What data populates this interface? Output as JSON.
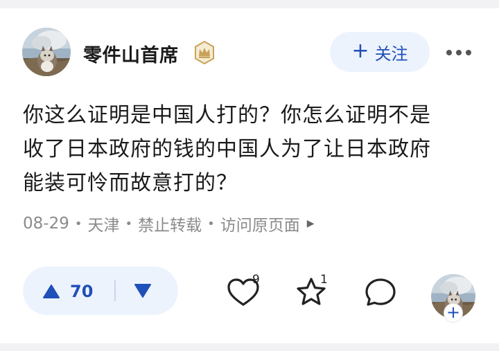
{
  "post": {
    "author": {
      "name": "零件山首席",
      "avatar": "cat-photo-avatar",
      "badge_icon": "crown-badge-icon"
    },
    "follow_button": {
      "icon": "plus-icon",
      "label": "关注"
    },
    "more_icon": "more-dots-icon",
    "content_lines": [
      "你这么证明是中国人打的？你怎么证明不是",
      "收了日本政府的钱的中国人为了让日本政府",
      "能装可怜而故意打的？"
    ],
    "meta": {
      "date": "08-29",
      "location": "天津",
      "repost": "禁止转载",
      "visit_link": "访问原页面",
      "separator": "•"
    },
    "actions": {
      "upvote_count": "70",
      "like_count": "9",
      "favorite_count": "1"
    }
  },
  "colors": {
    "accent": "#1f4fb8",
    "pill_bg": "#edf3fd",
    "meta_text": "#8a8a8a",
    "badge_gold": "#c9a25a"
  }
}
